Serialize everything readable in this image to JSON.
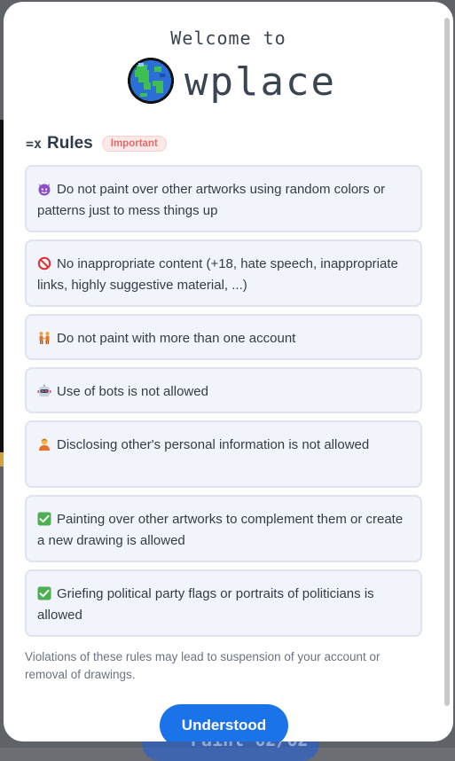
{
  "header": {
    "welcome": "Welcome to",
    "brand": "wplace",
    "logo_icon": "globe-icon"
  },
  "rules_section": {
    "icon": "rules-list-icon",
    "title": "Rules",
    "badge": "Important",
    "items": [
      {
        "icon": "devil-face-icon",
        "text": "Do not paint over other artworks using random colors or patterns just to mess things up"
      },
      {
        "icon": "prohibited-icon",
        "text": "No inappropriate content (+18, hate speech, inappropriate links, highly suggestive material, ...)"
      },
      {
        "icon": "people-holding-hands-icon",
        "text": "Do not paint with more than one account"
      },
      {
        "icon": "robot-icon",
        "text": "Use of bots is not allowed"
      },
      {
        "icon": "person-icon",
        "text": "Disclosing other's personal information is not allowed"
      },
      {
        "icon": "check-mark-icon",
        "text": "Painting over other artworks to complement them or create a new drawing is allowed"
      },
      {
        "icon": "check-mark-icon",
        "text": "Griefing political party flags or portraits of politicians is allowed"
      }
    ]
  },
  "footer": {
    "note": "Violations of these rules may lead to suspension of your account or removal of drawings.",
    "button_label": "Understood"
  },
  "background": {
    "paint_button_text": "Paint 62/62"
  },
  "colors": {
    "accent": "#1a73e8",
    "badge_text": "#e06c6c",
    "rule_bg": "#f1f5fb"
  }
}
